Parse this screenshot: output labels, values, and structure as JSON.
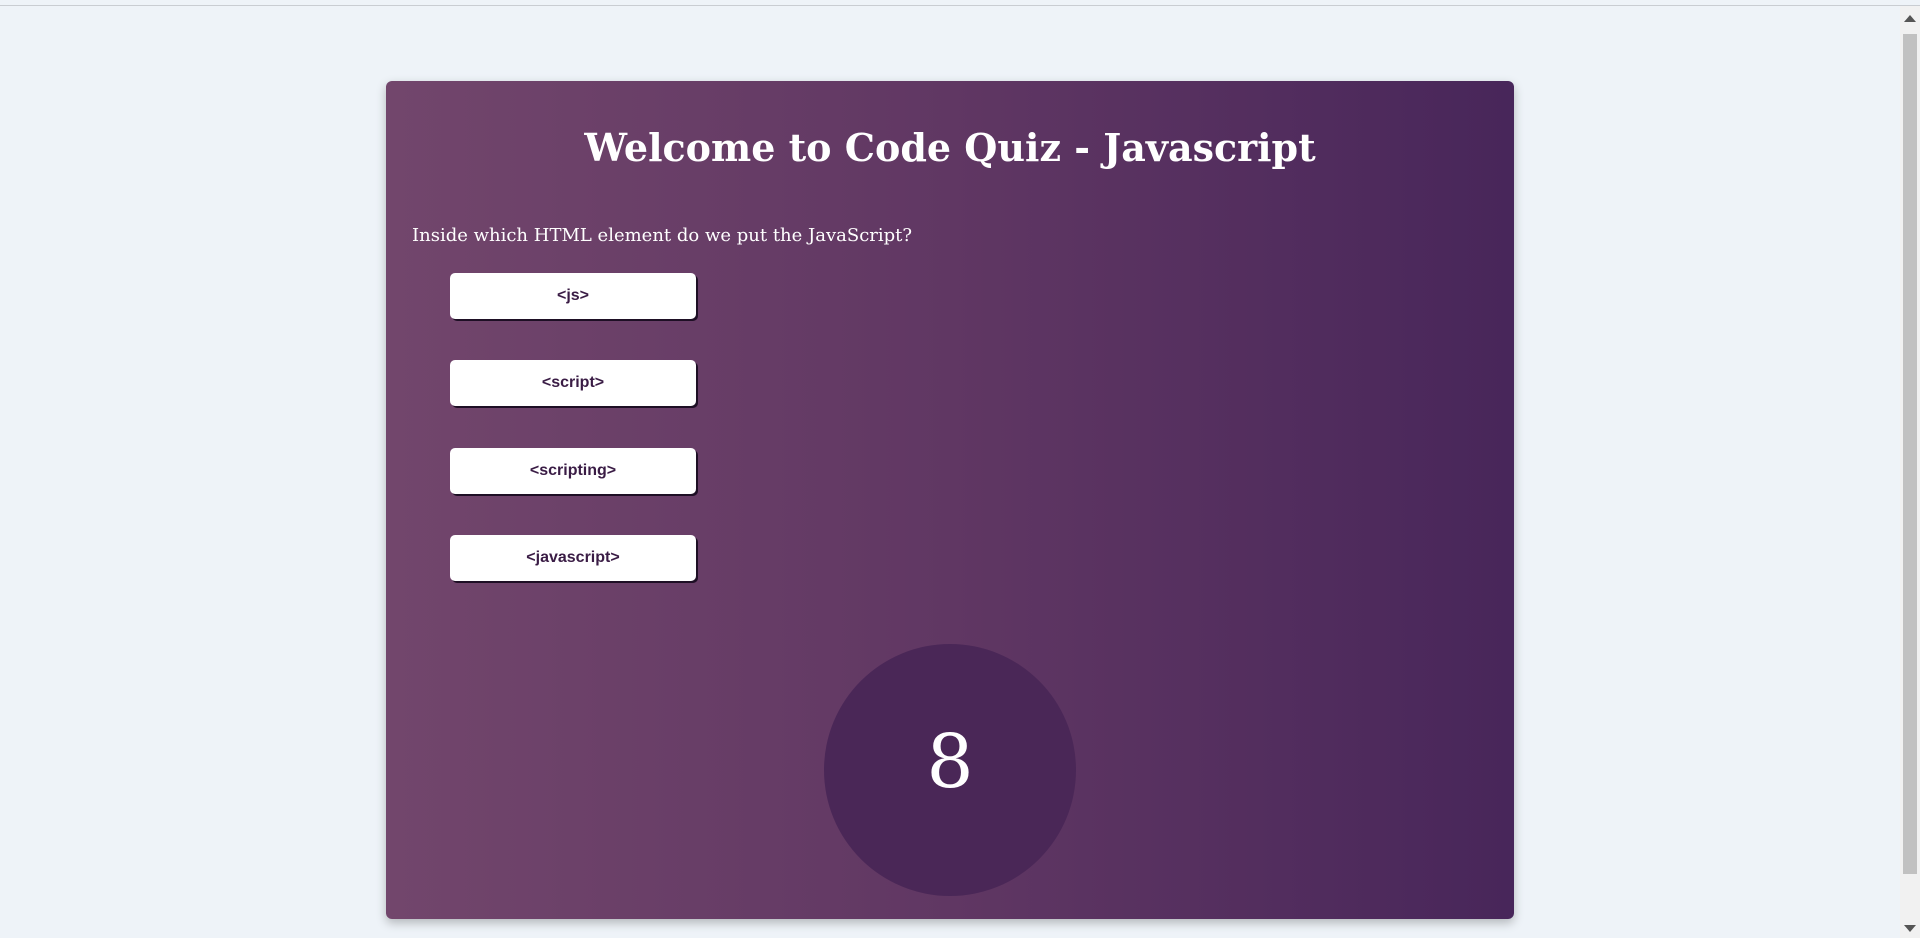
{
  "quiz": {
    "title": "Welcome to Code Quiz - Javascript",
    "question": "Inside which HTML element do we put the JavaScript?",
    "choices": [
      "<js>",
      "<script>",
      "<scripting>",
      "<javascript>"
    ],
    "timer": "8"
  },
  "colors": {
    "background": "#eef3f8",
    "card_gradient_start": "#72466c",
    "card_gradient_end": "#48265a",
    "timer_circle": "#4a2757",
    "button_text": "#3a1c45"
  }
}
